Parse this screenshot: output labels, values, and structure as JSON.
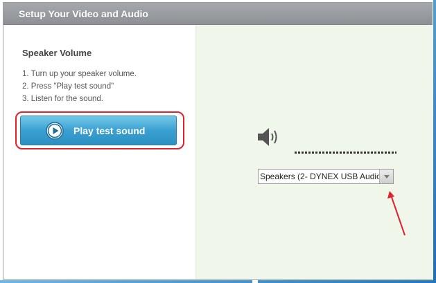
{
  "dialog": {
    "title": "Setup Your Video and Audio"
  },
  "speaker_section": {
    "heading": "Speaker Volume",
    "steps": [
      "1. Turn up your speaker volume.",
      "2. Press \"Play test sound\"",
      "3. Listen for the sound."
    ],
    "play_button_label": "Play test sound"
  },
  "output_device": {
    "selected": "Speakers (2- DYNEX USB Audio"
  },
  "icons": {
    "play": "play-circle-icon",
    "speaker": "speaker-volume-icon",
    "dropdown": "chevron-down-icon"
  },
  "colors": {
    "title_bar": "#999da1",
    "button_blue": "#3aa0d1",
    "highlight_red": "#e0202a",
    "right_pane_bg": "#f1f6ea"
  }
}
